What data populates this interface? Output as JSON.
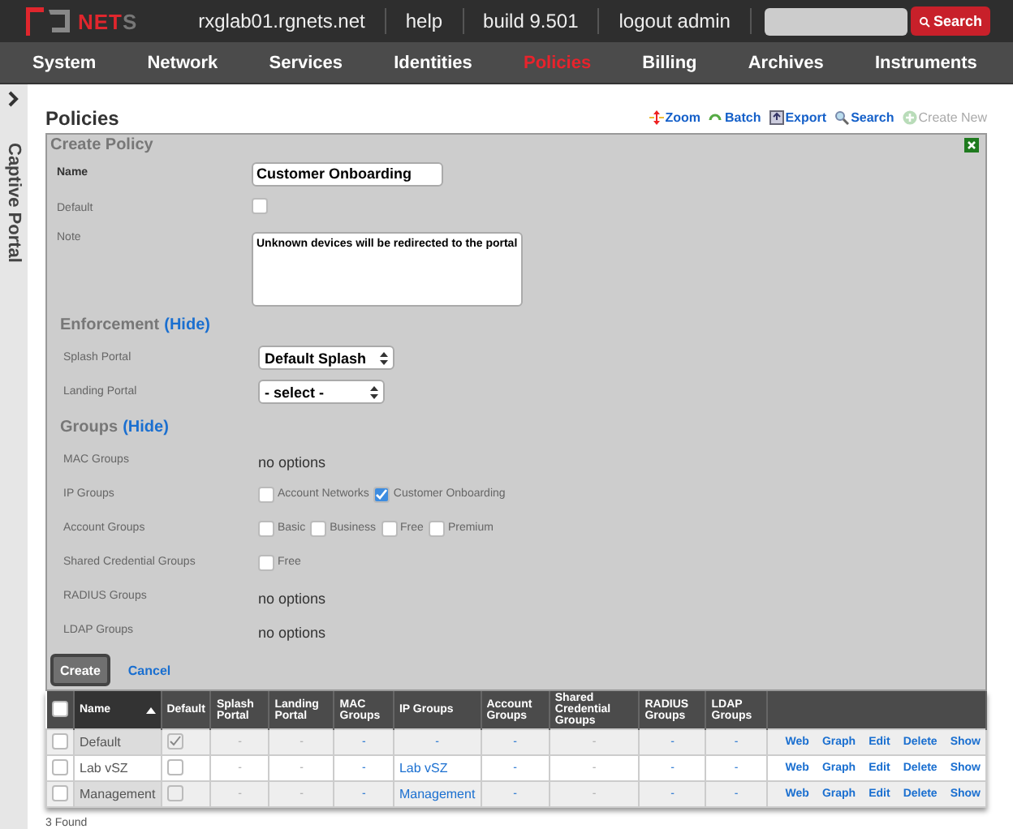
{
  "header": {
    "logo": {
      "text": "NET",
      "text_end": "S"
    },
    "links": [
      "rxglab01.rgnets.net",
      "help",
      "build 9.501",
      "logout admin"
    ],
    "search": {
      "button": "Search"
    }
  },
  "nav": [
    {
      "label": "System",
      "selected": false
    },
    {
      "label": "Network",
      "selected": false
    },
    {
      "label": "Services",
      "selected": false
    },
    {
      "label": "Identities",
      "selected": false
    },
    {
      "label": "Policies",
      "selected": true
    },
    {
      "label": "Billing",
      "selected": false
    },
    {
      "label": "Archives",
      "selected": false
    },
    {
      "label": "Instruments",
      "selected": false
    }
  ],
  "sidebar": {
    "title": "Captive Portal"
  },
  "page": {
    "title": "Policies",
    "tools": [
      {
        "label": "Zoom",
        "kind": "zoom",
        "disabled": false
      },
      {
        "label": "Batch",
        "kind": "batch",
        "disabled": false
      },
      {
        "label": "Export",
        "kind": "export",
        "disabled": false
      },
      {
        "label": "Search",
        "kind": "search",
        "disabled": false
      },
      {
        "label": "Create New",
        "kind": "create",
        "disabled": true
      }
    ]
  },
  "form": {
    "title": "Create Policy",
    "name": {
      "label": "Name",
      "value": "Customer Onboarding"
    },
    "default": {
      "label": "Default",
      "checked": false
    },
    "note": {
      "label": "Note",
      "value": "Unknown devices will be redirected to the portal"
    },
    "sections": [
      {
        "title": "Enforcement",
        "toggle": "(Hide)",
        "fields": [
          {
            "label": "Splash Portal",
            "kind": "select",
            "value": "Default Splash"
          },
          {
            "label": "Landing Portal",
            "kind": "select",
            "value": "- select -"
          }
        ]
      },
      {
        "title": "Groups",
        "toggle": "(Hide)",
        "fields": [
          {
            "label": "MAC Groups",
            "kind": "empty",
            "text": "no options"
          },
          {
            "label": "IP Groups",
            "kind": "checks",
            "options": [
              {
                "label": "Account Networks",
                "checked": false
              },
              {
                "label": "Customer Onboarding",
                "checked": true
              }
            ]
          },
          {
            "label": "Account Groups",
            "kind": "checks",
            "options": [
              {
                "label": "Basic",
                "checked": false
              },
              {
                "label": "Business",
                "checked": false
              },
              {
                "label": "Free",
                "checked": false
              },
              {
                "label": "Premium",
                "checked": false
              }
            ]
          },
          {
            "label": "Shared Credential Groups",
            "kind": "checks",
            "options": [
              {
                "label": "Free",
                "checked": false
              }
            ]
          },
          {
            "label": "RADIUS Groups",
            "kind": "empty",
            "text": "no options"
          },
          {
            "label": "LDAP Groups",
            "kind": "empty",
            "text": "no options"
          }
        ]
      }
    ],
    "create": "Create",
    "cancel": "Cancel"
  },
  "table": {
    "select_all": {
      "checked": false
    },
    "columns": [
      "Name",
      "Default",
      "Splash Portal",
      "Landing Portal",
      "MAC Groups",
      "IP Groups",
      "Account Groups",
      "Shared Credential Groups",
      "RADIUS Groups",
      "LDAP Groups"
    ],
    "rows": [
      {
        "checked": false,
        "cells": [
          {
            "kind": "name",
            "text": "Default"
          },
          {
            "kind": "check",
            "checked": true
          },
          {
            "kind": "text",
            "text": "-",
            "link": false
          },
          {
            "kind": "text",
            "text": "-",
            "link": false
          },
          {
            "kind": "text",
            "text": "-",
            "link": true
          },
          {
            "kind": "text",
            "text": "-",
            "link": true
          },
          {
            "kind": "text",
            "text": "-",
            "link": true
          },
          {
            "kind": "text",
            "text": "-",
            "link": false
          },
          {
            "kind": "text",
            "text": "-",
            "link": true
          },
          {
            "kind": "text",
            "text": "-",
            "link": true
          }
        ],
        "actions": [
          "Web",
          "Graph",
          "Edit",
          "Delete",
          "Show"
        ]
      },
      {
        "checked": false,
        "cells": [
          {
            "kind": "name",
            "text": "Lab vSZ"
          },
          {
            "kind": "check",
            "checked": false
          },
          {
            "kind": "text",
            "text": "-",
            "link": false
          },
          {
            "kind": "text",
            "text": "-",
            "link": false
          },
          {
            "kind": "text",
            "text": "-",
            "link": true
          },
          {
            "kind": "text",
            "text": "Lab vSZ",
            "link": true
          },
          {
            "kind": "text",
            "text": "-",
            "link": true
          },
          {
            "kind": "text",
            "text": "-",
            "link": false
          },
          {
            "kind": "text",
            "text": "-",
            "link": true
          },
          {
            "kind": "text",
            "text": "-",
            "link": true
          }
        ],
        "actions": [
          "Web",
          "Graph",
          "Edit",
          "Delete",
          "Show"
        ]
      },
      {
        "checked": false,
        "cells": [
          {
            "kind": "name",
            "text": "Management"
          },
          {
            "kind": "check",
            "checked": false
          },
          {
            "kind": "text",
            "text": "-",
            "link": false
          },
          {
            "kind": "text",
            "text": "-",
            "link": false
          },
          {
            "kind": "text",
            "text": "-",
            "link": true
          },
          {
            "kind": "text",
            "text": "Management",
            "link": true
          },
          {
            "kind": "text",
            "text": "-",
            "link": true
          },
          {
            "kind": "text",
            "text": "-",
            "link": false
          },
          {
            "kind": "text",
            "text": "-",
            "link": true
          },
          {
            "kind": "text",
            "text": "-",
            "link": true
          }
        ],
        "actions": [
          "Web",
          "Graph",
          "Edit",
          "Delete",
          "Show"
        ]
      }
    ],
    "found": "3 Found"
  }
}
